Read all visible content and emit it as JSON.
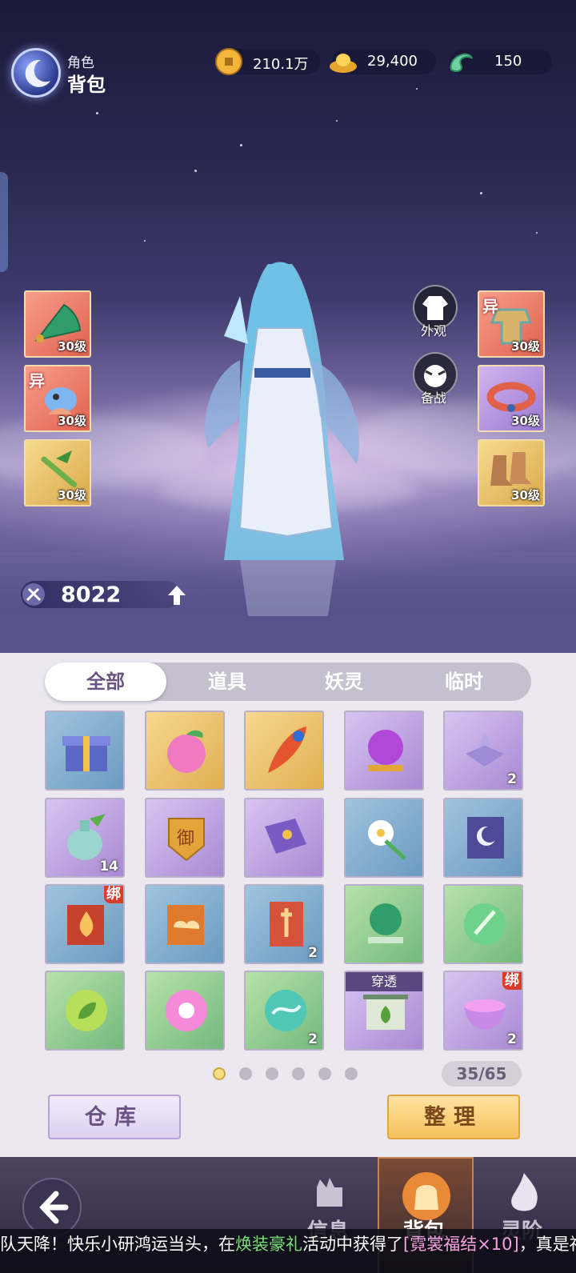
{
  "header": {
    "subtitle": "角色",
    "title": "背包"
  },
  "currencies": [
    {
      "icon": "coin-icon",
      "value": "210.1万"
    },
    {
      "icon": "gold-ingot-icon",
      "value": "29,400"
    },
    {
      "icon": "jade-dragon-icon",
      "value": "150"
    }
  ],
  "equipment": {
    "left": [
      {
        "name": "fan",
        "level": "30级",
        "tag": ""
      },
      {
        "name": "spirit-pet",
        "level": "30级",
        "tag": "异"
      },
      {
        "name": "bamboo-flute",
        "level": "30级",
        "tag": ""
      }
    ],
    "right": [
      {
        "name": "armor",
        "level": "30级",
        "tag": "异"
      },
      {
        "name": "belt",
        "level": "30级",
        "tag": ""
      },
      {
        "name": "boots",
        "level": "30级",
        "tag": ""
      }
    ]
  },
  "actions": {
    "appearance": "外观",
    "prepare": "备战"
  },
  "power": {
    "value": "8022"
  },
  "tabs": [
    "全部",
    "道具",
    "妖灵",
    "临时"
  ],
  "items": [
    {
      "name": "gift-box",
      "bg": "blue",
      "count": "",
      "bind": "",
      "badge": ""
    },
    {
      "name": "peach",
      "bg": "gold",
      "count": "",
      "bind": "",
      "badge": ""
    },
    {
      "name": "feather",
      "bg": "gold",
      "count": "",
      "bind": "",
      "badge": ""
    },
    {
      "name": "orb-stand",
      "bg": "purple",
      "count": "",
      "bind": "",
      "badge": ""
    },
    {
      "name": "lotus",
      "bg": "purple",
      "count": "2",
      "bind": "",
      "badge": ""
    },
    {
      "name": "jade-bottle",
      "bg": "purple",
      "count": "14",
      "bind": "",
      "badge": ""
    },
    {
      "name": "royal-token",
      "bg": "purple",
      "count": "",
      "bind": "",
      "badge": ""
    },
    {
      "name": "purple-book",
      "bg": "purple",
      "count": "",
      "bind": "",
      "badge": ""
    },
    {
      "name": "white-flower",
      "bg": "blue",
      "count": "",
      "bind": "",
      "badge": ""
    },
    {
      "name": "moon-book",
      "bg": "blue",
      "count": "",
      "bind": "",
      "badge": ""
    },
    {
      "name": "fire-book",
      "bg": "blue",
      "count": "",
      "bind": "绑",
      "badge": ""
    },
    {
      "name": "cloud-book",
      "bg": "blue",
      "count": "",
      "bind": "",
      "badge": ""
    },
    {
      "name": "sword-card",
      "bg": "blue",
      "count": "2",
      "bind": "",
      "badge": ""
    },
    {
      "name": "green-orb-stand",
      "bg": "green",
      "count": "",
      "bind": "",
      "badge": ""
    },
    {
      "name": "green-orb-flute",
      "bg": "green",
      "count": "",
      "bind": "",
      "badge": ""
    },
    {
      "name": "leaf-orb",
      "bg": "green",
      "count": "",
      "bind": "",
      "badge": ""
    },
    {
      "name": "blossom-orb",
      "bg": "green",
      "count": "",
      "bind": "",
      "badge": ""
    },
    {
      "name": "dragon-orb",
      "bg": "green",
      "count": "2",
      "bind": "",
      "badge": ""
    },
    {
      "name": "scroll",
      "bg": "purple",
      "count": "",
      "bind": "",
      "badge": "穿透"
    },
    {
      "name": "potion-bowl",
      "bg": "purple",
      "count": "2",
      "bind": "绑",
      "badge": ""
    }
  ],
  "pager": {
    "pages": 6,
    "current": 1,
    "capacity": "35/65"
  },
  "buttons": {
    "storage": "仓库",
    "sort": "整理"
  },
  "nav": {
    "info": "信息",
    "bag": "背包",
    "spirit": "灵阶"
  },
  "ticker": {
    "p1": "队天降！快乐小研鸿运当头，在",
    "p2": "焕装豪礼",
    "p3": "活动中获得了",
    "p4": "[霓裳福结×10]",
    "p5": "，真是福缘不浅"
  }
}
